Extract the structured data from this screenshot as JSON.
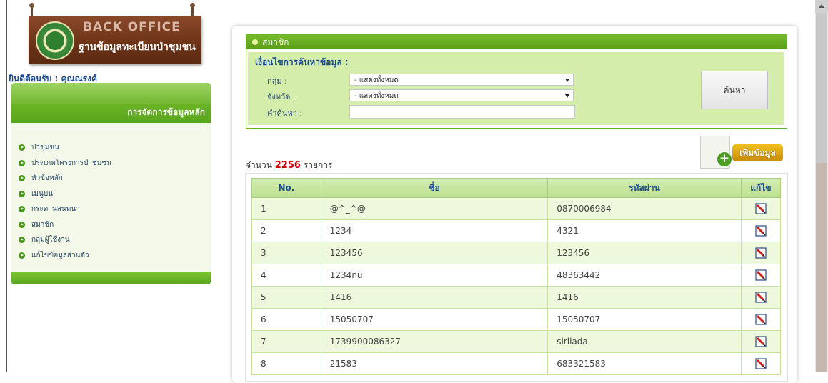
{
  "logo": {
    "title": "BACK OFFICE",
    "subtitle": "ฐานข้อมูลทะเบียนป่าชุมชน"
  },
  "sidebar": {
    "welcome": "ยินดีต้อนรับ : คุณณรงค์",
    "header": "การจัดการข้อมูลหลัก",
    "items": [
      {
        "label": "ป่าชุมชน"
      },
      {
        "label": "ประเภทโครงการป่าชุมชน"
      },
      {
        "label": "หัวข้อหลัก"
      },
      {
        "label": "เมนูบน"
      },
      {
        "label": "กระดานสนทนา"
      },
      {
        "label": "สมาชิก"
      },
      {
        "label": "กลุ่มผู้ใช้งาน"
      },
      {
        "label": "แก้ไขข้อมูลส่วนตัว"
      }
    ]
  },
  "panel": {
    "title": "สมาชิก",
    "search": {
      "heading": "เงื่อนไขการค้นหาข้อมูล :",
      "group_label": "กลุ่ม :",
      "group_value": "- แสดงทั้งหมด",
      "province_label": "จังหวัด :",
      "province_value": "- แสดงทั้งหมด",
      "keyword_label": "คำค้นหา :",
      "keyword_value": "",
      "button": "ค้นหา"
    },
    "count_prefix": "จำนวน",
    "count": "2256",
    "count_suffix": "รายการ",
    "add_button": "เพิ่มข้อมูล"
  },
  "table": {
    "headers": [
      "No.",
      "ชื่อ",
      "รหัสผ่าน",
      "แก้ไข"
    ],
    "rows": [
      {
        "no": "1",
        "name": "@^_^@",
        "password": "0870006984"
      },
      {
        "no": "2",
        "name": "1234",
        "password": "4321"
      },
      {
        "no": "3",
        "name": "123456",
        "password": "123456"
      },
      {
        "no": "4",
        "name": "1234nu",
        "password": "48363442"
      },
      {
        "no": "5",
        "name": "1416",
        "password": "1416"
      },
      {
        "no": "6",
        "name": "15050707",
        "password": "15050707"
      },
      {
        "no": "7",
        "name": "1739900086327",
        "password": "sirilada"
      },
      {
        "no": "8",
        "name": "21583",
        "password": "683321583"
      }
    ]
  },
  "colors": {
    "green": "#5aa51c",
    "row_alt": "#eef8dc",
    "count": "#d00000",
    "link": "#1a4d8f"
  }
}
